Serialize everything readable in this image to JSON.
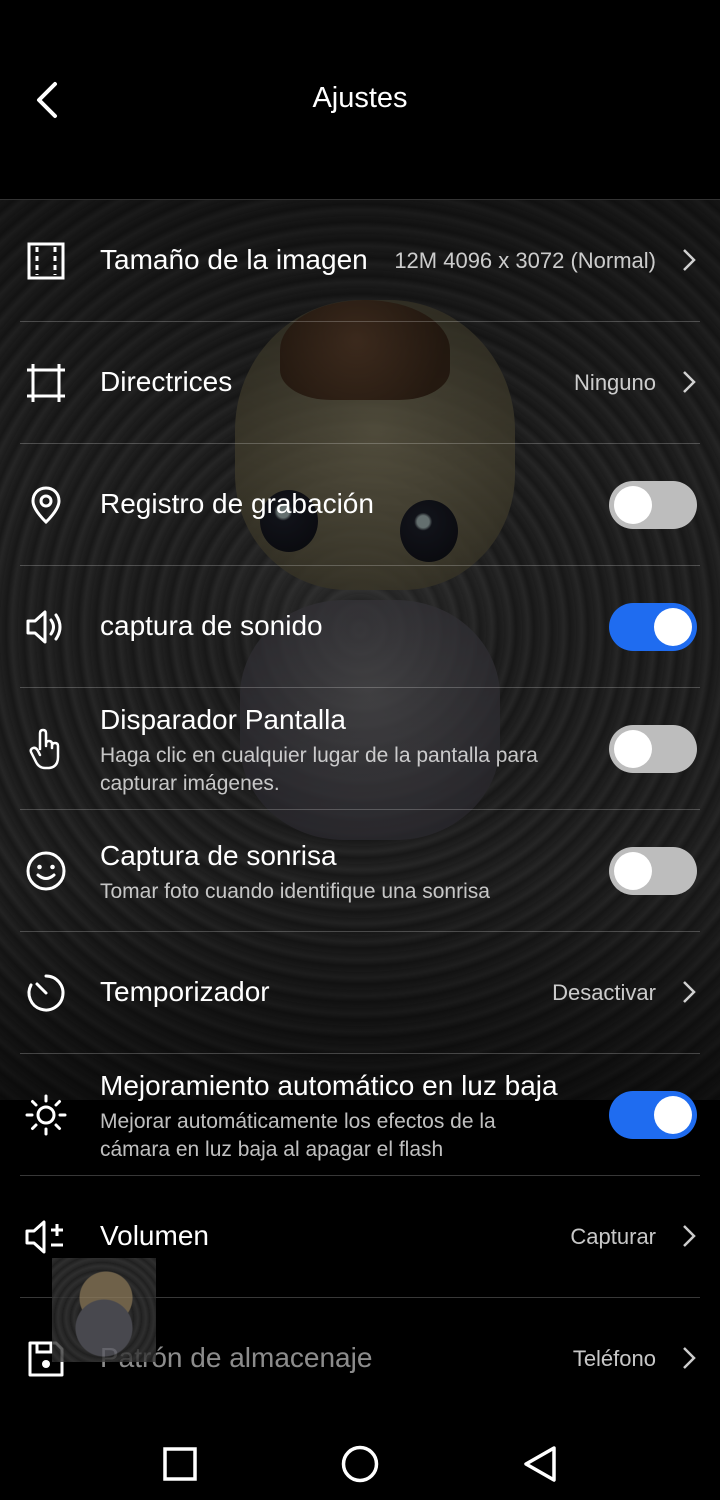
{
  "header": {
    "title": "Ajustes",
    "back_icon": "chevron-left-icon"
  },
  "settings": [
    {
      "icon": "image-size-icon",
      "label": "Tamaño de la imagen",
      "value": "12M 4096 x 3072 (Normal)",
      "control": "chevron"
    },
    {
      "icon": "crop-grid-icon",
      "label": "Directrices",
      "value": "Ninguno",
      "control": "chevron"
    },
    {
      "icon": "location-pin-icon",
      "label": "Registro de grabación",
      "control": "toggle",
      "enabled": false
    },
    {
      "icon": "speaker-icon",
      "label": "captura de sonido",
      "control": "toggle",
      "enabled": true
    },
    {
      "icon": "touch-hand-icon",
      "label": "Disparador Pantalla",
      "sublabel": "Haga clic en cualquier lugar de la pantalla para capturar imágenes.",
      "control": "toggle",
      "enabled": false
    },
    {
      "icon": "smile-icon",
      "label": "Captura de sonrisa",
      "sublabel": "Tomar foto cuando identifique una sonrisa",
      "control": "toggle",
      "enabled": false
    },
    {
      "icon": "timer-icon",
      "label": "Temporizador",
      "value": "Desactivar",
      "control": "chevron"
    },
    {
      "icon": "brightness-icon",
      "label": "Mejoramiento automático en luz baja",
      "sublabel": "Mejorar automáticamente los efectos de la cámara en luz baja al apagar el flash",
      "control": "toggle",
      "enabled": true
    },
    {
      "icon": "volume-plus-icon",
      "label": "Volumen",
      "value": "Capturar",
      "control": "chevron"
    },
    {
      "icon": "storage-icon",
      "label": "Patrón de almacenaje",
      "value": "Teléfono",
      "control": "chevron"
    }
  ],
  "navbar": {
    "recent_icon": "square-icon",
    "home_icon": "circle-icon",
    "back_icon": "triangle-back-icon"
  },
  "colors": {
    "background": "#000000",
    "toggle_on": "#1f6cf0",
    "toggle_off": "#bdbdbd"
  }
}
